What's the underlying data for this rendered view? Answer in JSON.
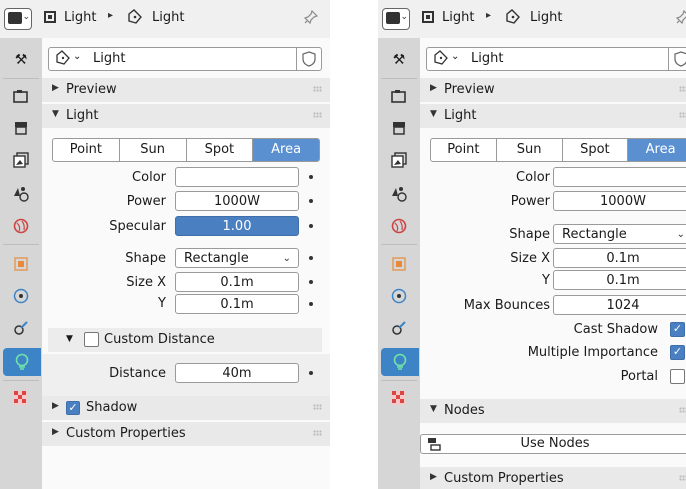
{
  "left_panel": {
    "breadcrumb": [
      "Light",
      "Light"
    ],
    "datablock_name": "Light",
    "preview_label": "Preview",
    "light_label": "Light",
    "light_types": [
      "Point",
      "Sun",
      "Spot",
      "Area"
    ],
    "active_light_type": "Area",
    "color_label": "Color",
    "power_label": "Power",
    "power_value": "1000W",
    "specular_label": "Specular",
    "specular_value": "1.00",
    "shape_label": "Shape",
    "shape_value": "Rectangle",
    "size_x_label": "Size X",
    "size_x_value": "0.1m",
    "size_y_label": "Y",
    "size_y_value": "0.1m",
    "custom_distance_label": "Custom Distance",
    "distance_label": "Distance",
    "distance_value": "40m",
    "shadow_label": "Shadow",
    "custom_properties_label": "Custom Properties"
  },
  "right_panel": {
    "breadcrumb": [
      "Light",
      "Light"
    ],
    "datablock_name": "Light",
    "preview_label": "Preview",
    "light_label": "Light",
    "light_types": [
      "Point",
      "Sun",
      "Spot",
      "Area"
    ],
    "active_light_type": "Area",
    "color_label": "Color",
    "power_label": "Power",
    "power_value": "1000W",
    "shape_label": "Shape",
    "shape_value": "Rectangle",
    "size_x_label": "Size X",
    "size_x_value": "0.1m",
    "size_y_label": "Y",
    "size_y_value": "0.1m",
    "max_bounces_label": "Max Bounces",
    "max_bounces_value": "1024",
    "cast_shadow_label": "Cast Shadow",
    "multiple_importance_label": "Multiple Importance",
    "portal_label": "Portal",
    "nodes_label": "Nodes",
    "use_nodes_label": "Use Nodes",
    "custom_properties_label": "Custom Properties"
  },
  "colors": {
    "accent": "#4a7fc1",
    "active_tab": "#3d84c6"
  },
  "icons": [
    "editor-type-icon",
    "object-data-icon",
    "light-data-icon",
    "pin-icon",
    "fake-user-shield-icon"
  ]
}
